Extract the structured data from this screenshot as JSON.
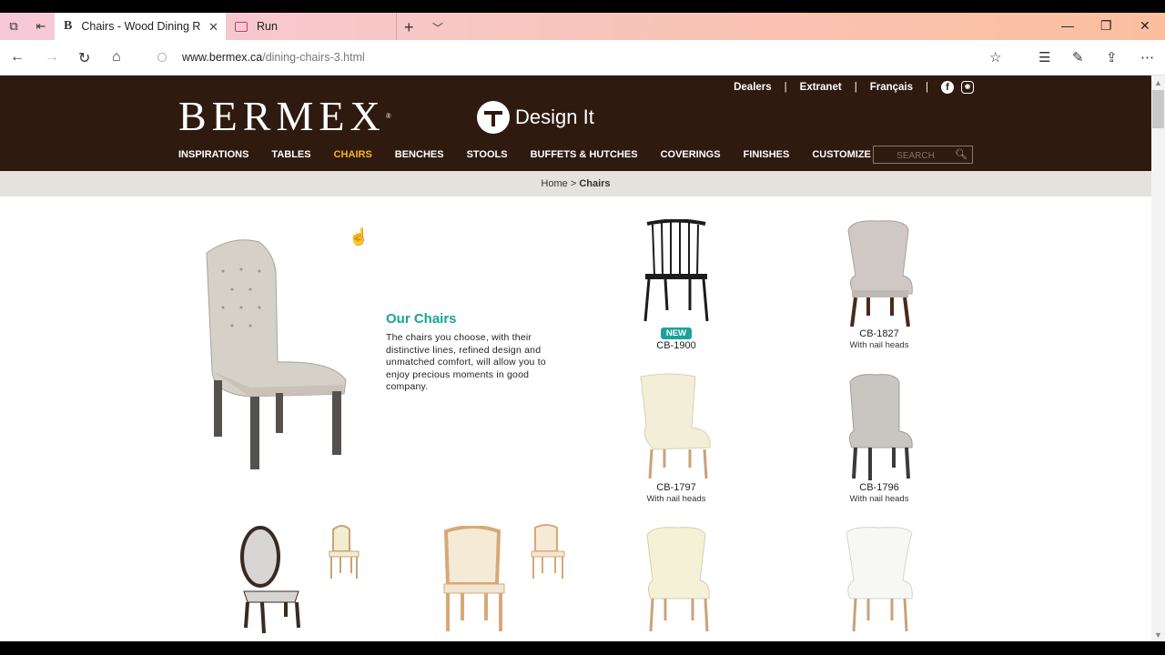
{
  "browser": {
    "tabs": [
      {
        "favicon": "B",
        "title": "Chairs - Wood Dining R",
        "active": true
      },
      {
        "favicon": "window-icon",
        "title": "Run",
        "active": false
      }
    ],
    "url_host": "www.bermex.ca",
    "url_path": "/dining-chairs-3.html"
  },
  "site": {
    "logo": "BERMEX",
    "logo_mark": "®",
    "design_it": "Design It",
    "top_links": [
      "Dealers",
      "Extranet",
      "Français"
    ],
    "nav": [
      "INSPIRATIONS",
      "TABLES",
      "CHAIRS",
      "BENCHES",
      "STOOLS",
      "BUFFETS & HUTCHES",
      "COVERINGS",
      "FINISHES",
      "CUSTOMIZE"
    ],
    "nav_active": "CHAIRS",
    "search_placeholder": "SEARCH",
    "breadcrumb": {
      "home": "Home",
      "sep": " > ",
      "current": "Chairs"
    }
  },
  "intro": {
    "title": "Our Chairs",
    "body": "The chairs you choose, with their distinctive lines, refined design and unmatched comfort, will allow you to enjoy precious moments in good company."
  },
  "products": [
    {
      "code": "CB-1900",
      "subtitle": "",
      "badge": "NEW"
    },
    {
      "code": "CB-1827",
      "subtitle": "With nail heads",
      "badge": ""
    },
    {
      "code": "CB-1797",
      "subtitle": "With nail heads",
      "badge": ""
    },
    {
      "code": "CB-1796",
      "subtitle": "With nail heads",
      "badge": ""
    }
  ],
  "colors": {
    "header_bg": "#2f1a0f",
    "nav_active": "#f2b51c",
    "accent_teal": "#1aa39a",
    "breadcrumb_bg": "#e5e1dc"
  }
}
